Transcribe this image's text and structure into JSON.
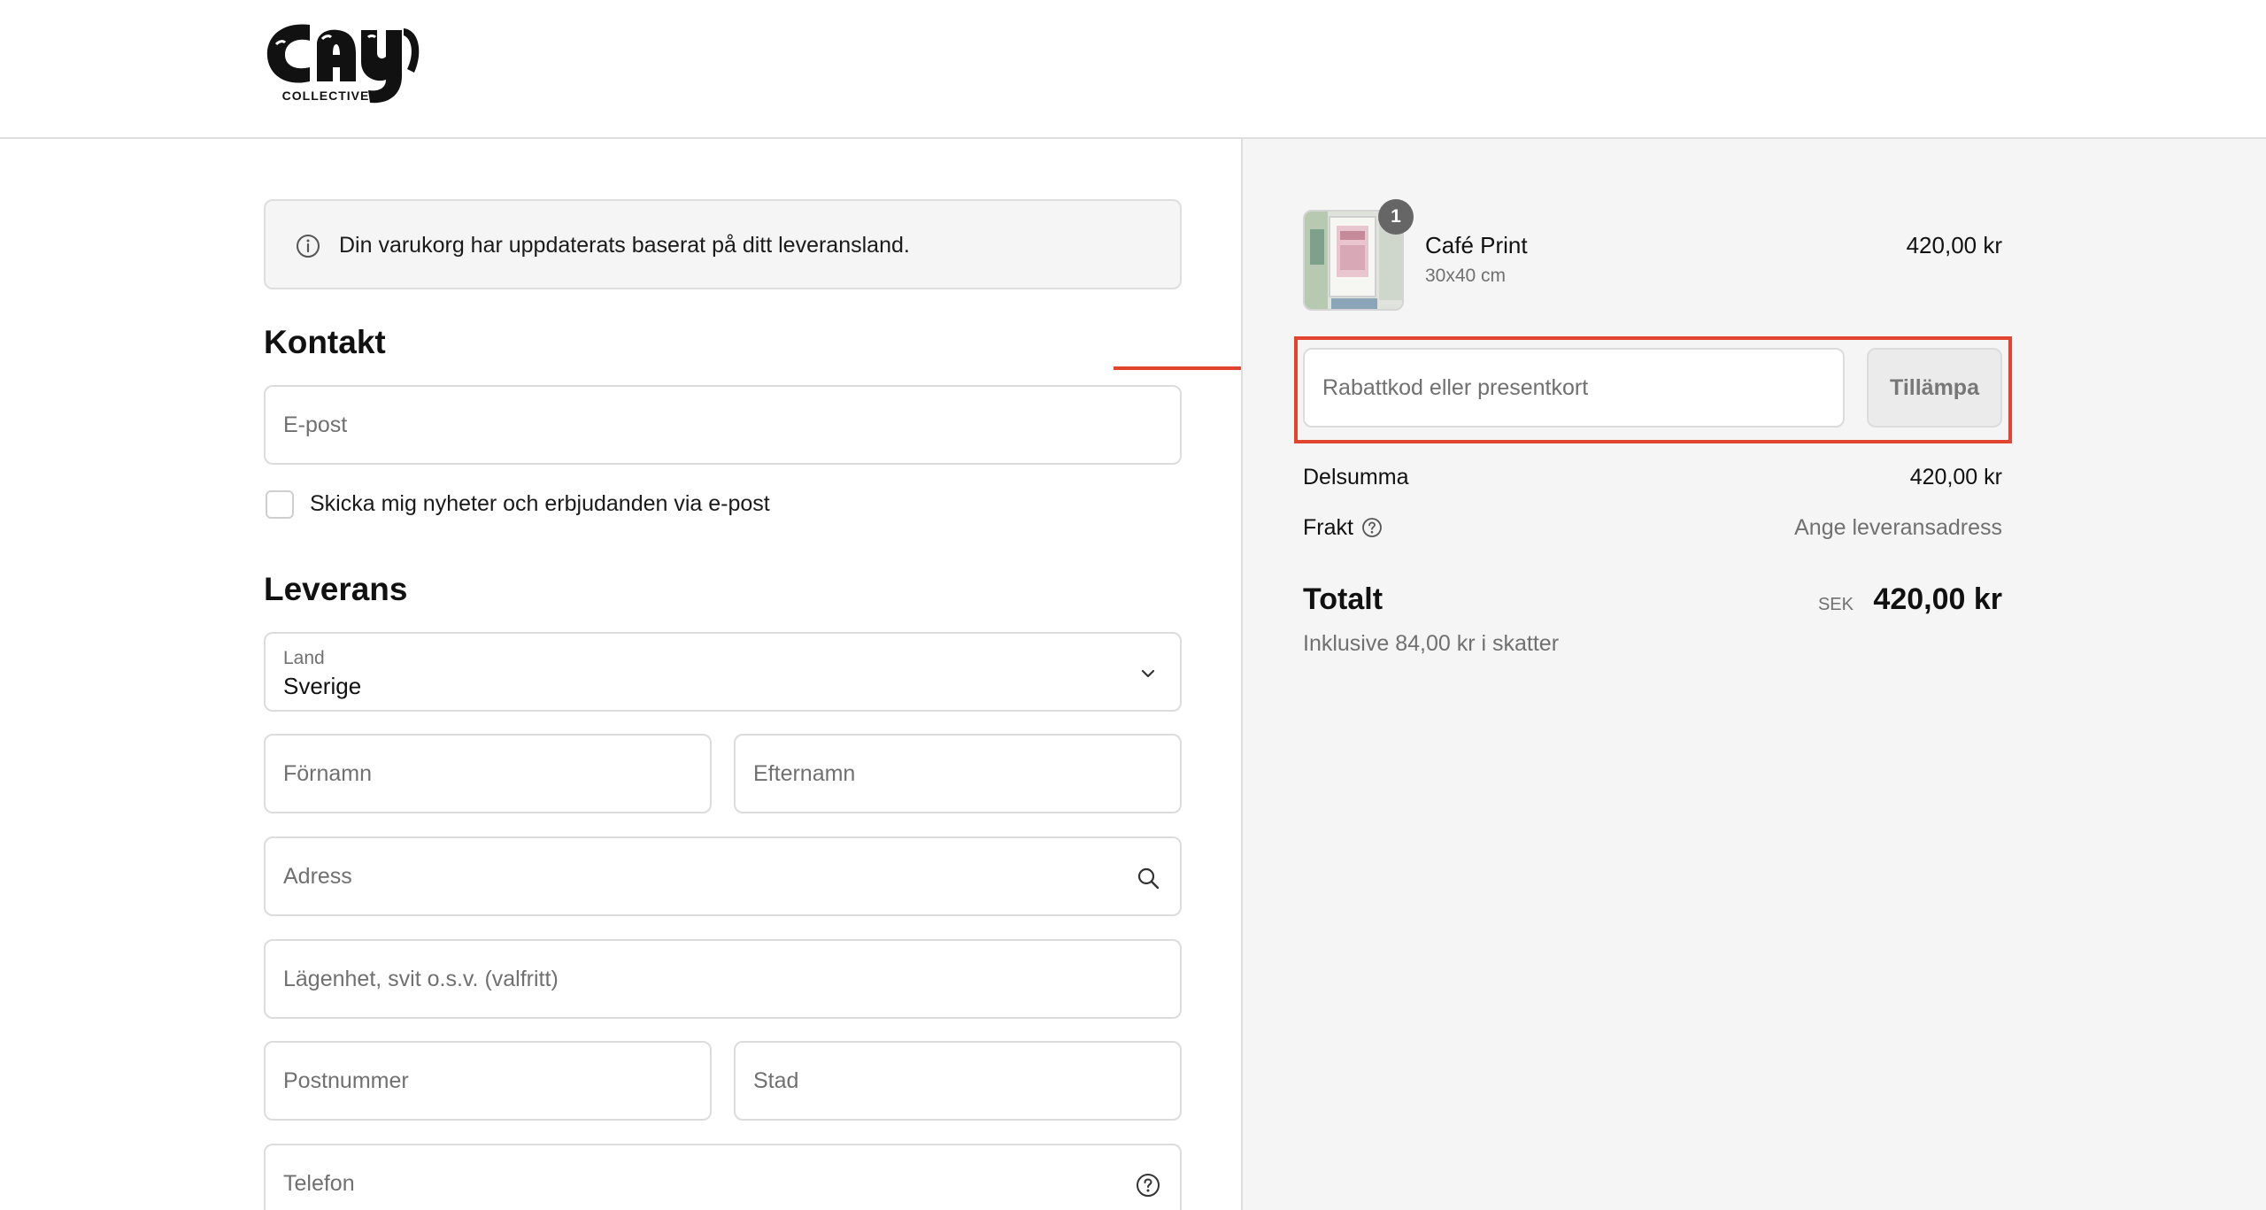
{
  "brand": {
    "logo_subtitle": "COLLECTIVE"
  },
  "notice": {
    "text": "Din varukorg har uppdaterats baserat på ditt leveransland.",
    "icon": "info-icon"
  },
  "contact": {
    "title": "Kontakt",
    "email_placeholder": "E-post",
    "newsletter_label": "Skicka mig nyheter och erbjudanden via e-post"
  },
  "delivery": {
    "title": "Leverans",
    "country_label": "Land",
    "country_value": "Sverige",
    "first_name_placeholder": "Förnamn",
    "last_name_placeholder": "Efternamn",
    "address_placeholder": "Adress",
    "apartment_placeholder": "Lägenhet, svit o.s.v. (valfritt)",
    "postal_placeholder": "Postnummer",
    "city_placeholder": "Stad",
    "phone_placeholder": "Telefon"
  },
  "summary": {
    "product": {
      "name": "Café Print",
      "variant": "30x40 cm",
      "price": "420,00 kr",
      "quantity": "1"
    },
    "discount_placeholder": "Rabattkod eller presentkort",
    "apply_label": "Tillämpa",
    "subtotal_label": "Delsumma",
    "subtotal_value": "420,00 kr",
    "shipping_label": "Frakt",
    "shipping_value": "Ange leveransadress",
    "total_label": "Totalt",
    "total_currency": "SEK",
    "total_value": "420,00 kr",
    "tax_note": "Inklusive 84,00 kr i skatter"
  },
  "colors": {
    "highlight": "#e2452f",
    "panel_bg": "#f5f5f5",
    "border": "#dcdcdc"
  }
}
